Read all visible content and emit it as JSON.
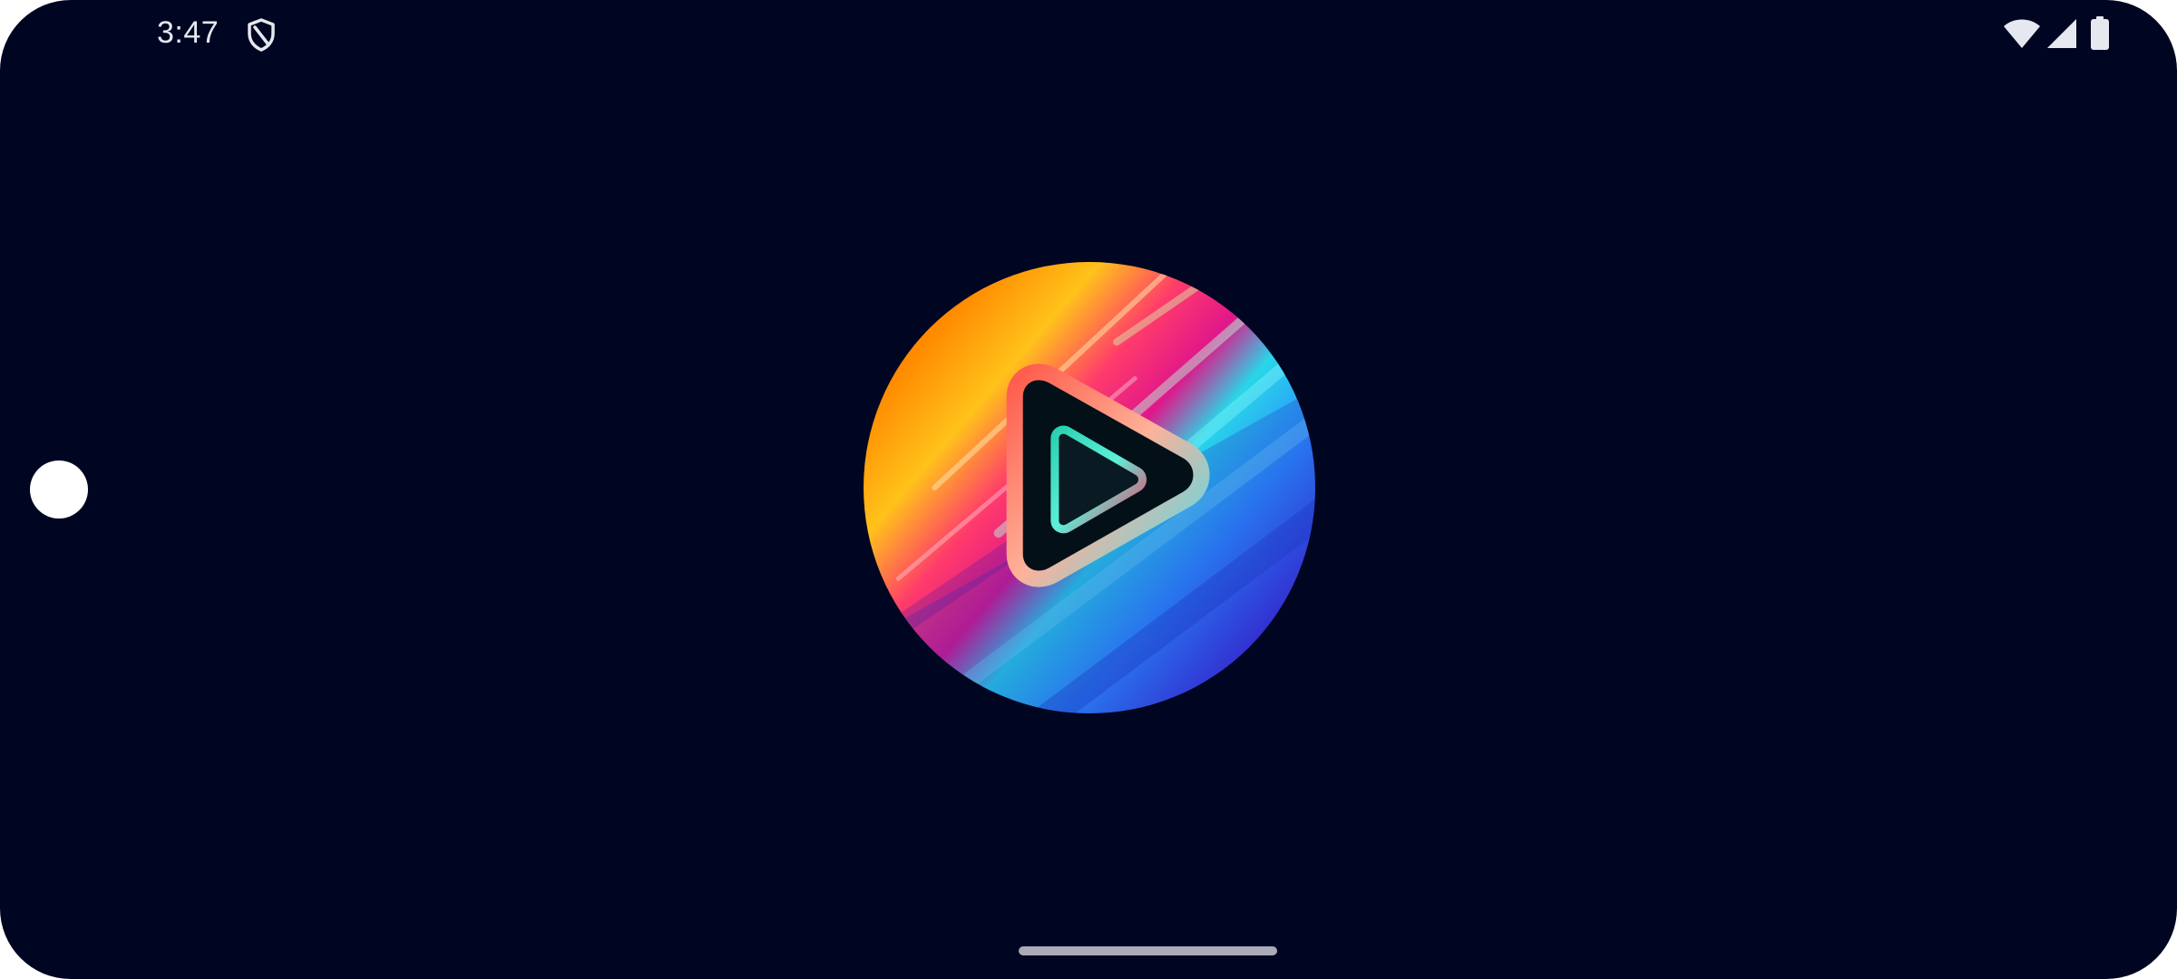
{
  "status_bar": {
    "time": "3:47",
    "icons": [
      "shield-icon",
      "wifi-icon",
      "signal-icon",
      "battery-icon"
    ]
  },
  "splash": {
    "logo": "rainbow-play-logo-icon",
    "background_color": "#000521"
  },
  "colors": {
    "status_text": "#e6e8f0",
    "home_indicator": "#a9abb8",
    "logo_gradient": [
      "#ff2d55",
      "#ff9f0a",
      "#ffd60a",
      "#34d399",
      "#22d3ee",
      "#3b82f6",
      "#7c3aed"
    ]
  }
}
